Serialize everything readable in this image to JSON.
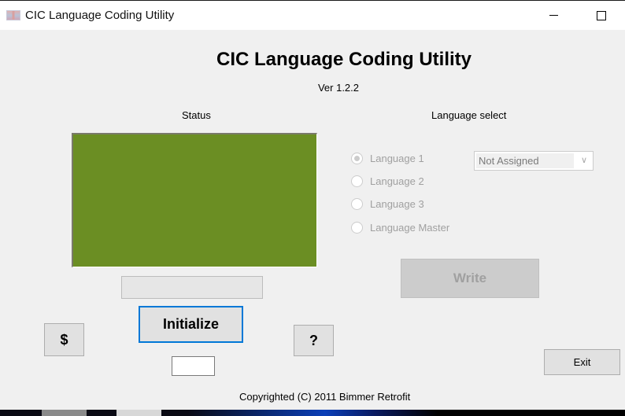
{
  "window": {
    "title": "CIC Language Coding Utility",
    "icon": "uk-flag-icon",
    "minimize_icon": "minimize-icon",
    "maximize_icon": "maximize-icon"
  },
  "header": {
    "title": "CIC Language Coding Utility",
    "version": "Ver 1.2.2"
  },
  "status": {
    "label": "Status",
    "panel_color": "#6b8e23",
    "progress_text": ""
  },
  "language_select": {
    "label": "Language select",
    "options": [
      {
        "label": "Language 1",
        "selected": true,
        "enabled": false
      },
      {
        "label": "Language 2",
        "selected": false,
        "enabled": false
      },
      {
        "label": "Language 3",
        "selected": false,
        "enabled": false
      },
      {
        "label": "Language Master",
        "selected": false,
        "enabled": false
      }
    ],
    "dropdown_value": "Not Assigned"
  },
  "buttons": {
    "donate": "$",
    "initialize": "Initialize",
    "help": "?",
    "write": "Write",
    "exit": "Exit"
  },
  "small_input_value": "",
  "footer": {
    "copyright": "Copyrighted (C) 2011 Bimmer Retrofit"
  },
  "colors": {
    "accent": "#0078d7",
    "status_green": "#6b8e23",
    "disabled_text": "#a0a0a0"
  }
}
